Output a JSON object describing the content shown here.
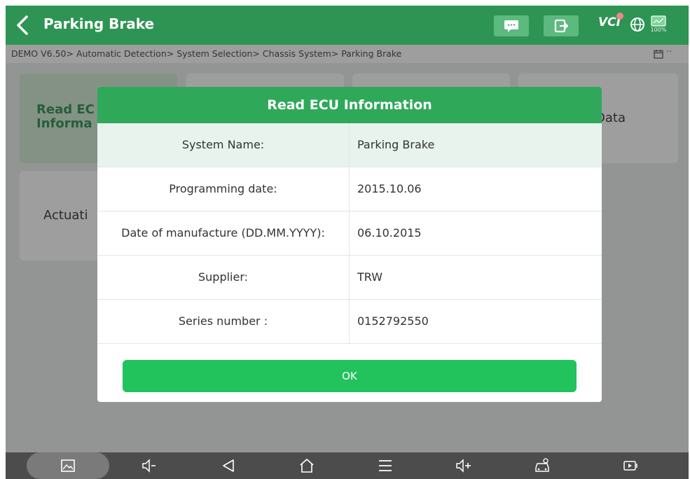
{
  "header": {
    "title": "Parking Brake",
    "vci_label": "VCI",
    "battery_pct": "100%"
  },
  "breadcrumb": {
    "path": "DEMO V6.50> Automatic Detection> System Selection> Chassis System> Parking Brake",
    "more": "··"
  },
  "tiles": [
    {
      "line1": "Read EC",
      "line2": "Informa"
    },
    {
      "line1": "Data"
    },
    {
      "line1": "Actuati"
    }
  ],
  "dialog": {
    "title": "Read ECU Information",
    "rows": [
      {
        "label": "System Name:",
        "value": "Parking Brake"
      },
      {
        "label": "Programming date:",
        "value": "2015.10.06"
      },
      {
        "label": "Date of manufacture (DD.MM.YYYY):",
        "value": "06.10.2015"
      },
      {
        "label": "Supplier:",
        "value": "TRW"
      },
      {
        "label": "Series number :",
        "value": "0152792550"
      }
    ],
    "ok_label": "OK"
  },
  "icons": {
    "header": [
      "back-icon",
      "feedback-icon",
      "exit-icon",
      "globe-icon",
      "battery-icon"
    ],
    "nav": [
      "screenshot-icon",
      "volume-down-icon",
      "back-triangle-icon",
      "home-icon",
      "menu-icon",
      "volume-up-icon",
      "car-diagnostic-icon",
      "screen-record-icon"
    ]
  },
  "colors": {
    "header": "#2e9454",
    "dialog_title": "#2fa85a",
    "ok_button": "#22c25c",
    "navbar": "#4c4c4c"
  }
}
